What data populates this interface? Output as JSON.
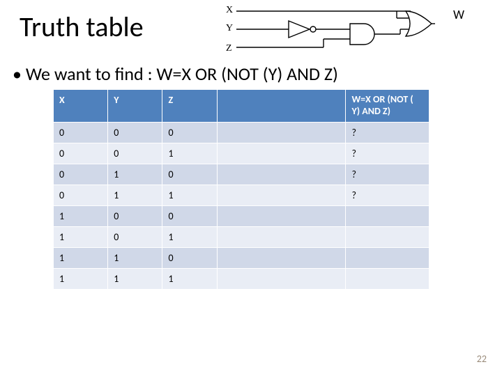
{
  "title": "Truth table",
  "labels": {
    "x": "X",
    "y": "Y",
    "z": "Z",
    "w": "W"
  },
  "bullet": "• We want to find : W=X OR (NOT (Y) AND Z)",
  "table": {
    "headers": {
      "x": "X",
      "y": "Y",
      "z": "Z",
      "gap": "",
      "w": "W=X OR (NOT ( Y) AND Z)"
    },
    "rows": [
      {
        "x": "0",
        "y": "0",
        "z": "0",
        "gap": "",
        "w": "?"
      },
      {
        "x": "0",
        "y": "0",
        "z": "1",
        "gap": "",
        "w": "?"
      },
      {
        "x": "0",
        "y": "1",
        "z": "0",
        "gap": "",
        "w": "?"
      },
      {
        "x": "0",
        "y": "1",
        "z": "1",
        "gap": "",
        "w": "?"
      },
      {
        "x": "1",
        "y": "0",
        "z": "0",
        "gap": "",
        "w": ""
      },
      {
        "x": "1",
        "y": "0",
        "z": "1",
        "gap": "",
        "w": ""
      },
      {
        "x": "1",
        "y": "1",
        "z": "0",
        "gap": "",
        "w": ""
      },
      {
        "x": "1",
        "y": "1",
        "z": "1",
        "gap": "",
        "w": ""
      }
    ]
  },
  "page_number": "22",
  "chart_data": {
    "type": "table",
    "title": "Truth table for W = X OR (NOT(Y) AND Z)",
    "columns": [
      "X",
      "Y",
      "Z",
      "W=X OR (NOT(Y) AND Z)"
    ],
    "rows": [
      [
        "0",
        "0",
        "0",
        "?"
      ],
      [
        "0",
        "0",
        "1",
        "?"
      ],
      [
        "0",
        "1",
        "0",
        "?"
      ],
      [
        "0",
        "1",
        "1",
        "?"
      ],
      [
        "1",
        "0",
        "0",
        ""
      ],
      [
        "1",
        "0",
        "1",
        ""
      ],
      [
        "1",
        "1",
        "0",
        ""
      ],
      [
        "1",
        "1",
        "1",
        ""
      ]
    ]
  }
}
